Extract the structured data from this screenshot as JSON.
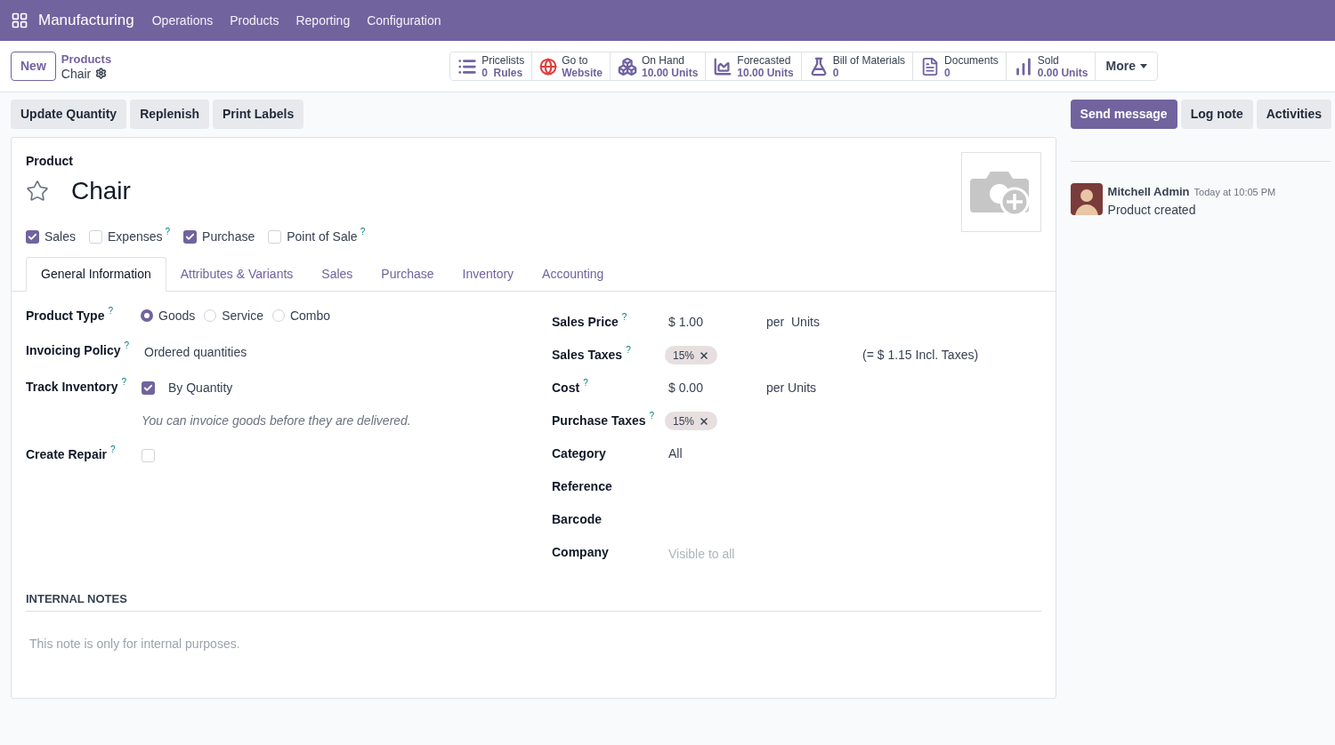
{
  "navbar": {
    "app": "Manufacturing",
    "menu": [
      "Operations",
      "Products",
      "Reporting",
      "Configuration"
    ]
  },
  "control_panel": {
    "new_button": "New",
    "breadcrumb": {
      "parent": "Products",
      "current": "Chair"
    },
    "smart_buttons": [
      {
        "kind": "pricelist",
        "label": "Pricelists",
        "value": "0  Rules"
      },
      {
        "kind": "website",
        "label": "Go to",
        "value": "Website"
      },
      {
        "kind": "onhand",
        "label": "On Hand",
        "value": "10.00 Units"
      },
      {
        "kind": "forecast",
        "label": "Forecasted",
        "value": "10.00 Units"
      },
      {
        "kind": "bom",
        "label": "Bill of Materials",
        "value": "0"
      },
      {
        "kind": "documents",
        "label": "Documents",
        "value": "0"
      },
      {
        "kind": "sold",
        "label": "Sold",
        "value": "0.00 Units"
      }
    ],
    "more_button": "More"
  },
  "actions": [
    "Update Quantity",
    "Replenish",
    "Print Labels"
  ],
  "chatter_buttons": [
    {
      "label": "Send message",
      "kind": "primary"
    },
    {
      "label": "Log note",
      "kind": "secondary"
    },
    {
      "label": "Activities",
      "kind": "secondary"
    }
  ],
  "form": {
    "caption": "Product",
    "name": "Chair",
    "favorite": false,
    "flags": [
      {
        "label": "Sales",
        "checked": true
      },
      {
        "label": "Expenses",
        "checked": false,
        "help": "?"
      },
      {
        "label": "Purchase",
        "checked": true
      },
      {
        "label": "Point of Sale",
        "checked": false,
        "help": "?"
      }
    ],
    "tabs": [
      {
        "label": "General Information",
        "selected": true
      },
      {
        "label": "Attributes & Variants",
        "selected": false
      },
      {
        "label": "Sales",
        "selected": false
      },
      {
        "label": "Purchase",
        "selected": false
      },
      {
        "label": "Inventory",
        "selected": false
      },
      {
        "label": "Accounting",
        "selected": false
      }
    ],
    "left_fields": [
      {
        "kind": "radio",
        "label": "Product Type",
        "help": "?",
        "options": [
          {
            "label": "Goods",
            "selected": true
          },
          {
            "label": "Service",
            "selected": false
          },
          {
            "label": "Combo",
            "selected": false
          }
        ]
      },
      {
        "kind": "text",
        "label": "Invoicing Policy",
        "help": "?",
        "value": "Ordered quantities"
      },
      {
        "kind": "checkbox",
        "label": "Track Inventory",
        "help": "?",
        "checked": true,
        "value": "By Quantity",
        "note": "You can invoice goods before they are delivered."
      },
      {
        "kind": "checkbox",
        "label": "Create Repair",
        "help": "?",
        "checked": false
      }
    ],
    "right_fields": [
      {
        "kind": "money",
        "label": "Sales Price",
        "help": "?",
        "value": "$ 1.00",
        "suffix": "per  Units"
      },
      {
        "kind": "tags",
        "label": "Sales Taxes",
        "help": "?",
        "tags": [
          "15%"
        ],
        "extra": "(= $ 1.15 Incl. Taxes)"
      },
      {
        "kind": "money",
        "label": "Cost",
        "help": "?",
        "value": "$ 0.00",
        "suffix": "per Units"
      },
      {
        "kind": "tags",
        "label": "Purchase Taxes",
        "help": "?",
        "tags": [
          "15%"
        ]
      },
      {
        "kind": "text",
        "label": "Category",
        "value": "All"
      },
      {
        "kind": "text",
        "label": "Reference"
      },
      {
        "kind": "text",
        "label": "Barcode"
      },
      {
        "kind": "placeholder",
        "label": "Company",
        "placeholder": "Visible to all"
      }
    ],
    "internal_notes": {
      "title": "INTERNAL NOTES",
      "placeholder": "This note is only for internal purposes."
    }
  },
  "chatter": {
    "messages": [
      {
        "author": "Mitchell Admin",
        "time": "Today at 10:05 PM",
        "body": "Product created"
      }
    ]
  }
}
